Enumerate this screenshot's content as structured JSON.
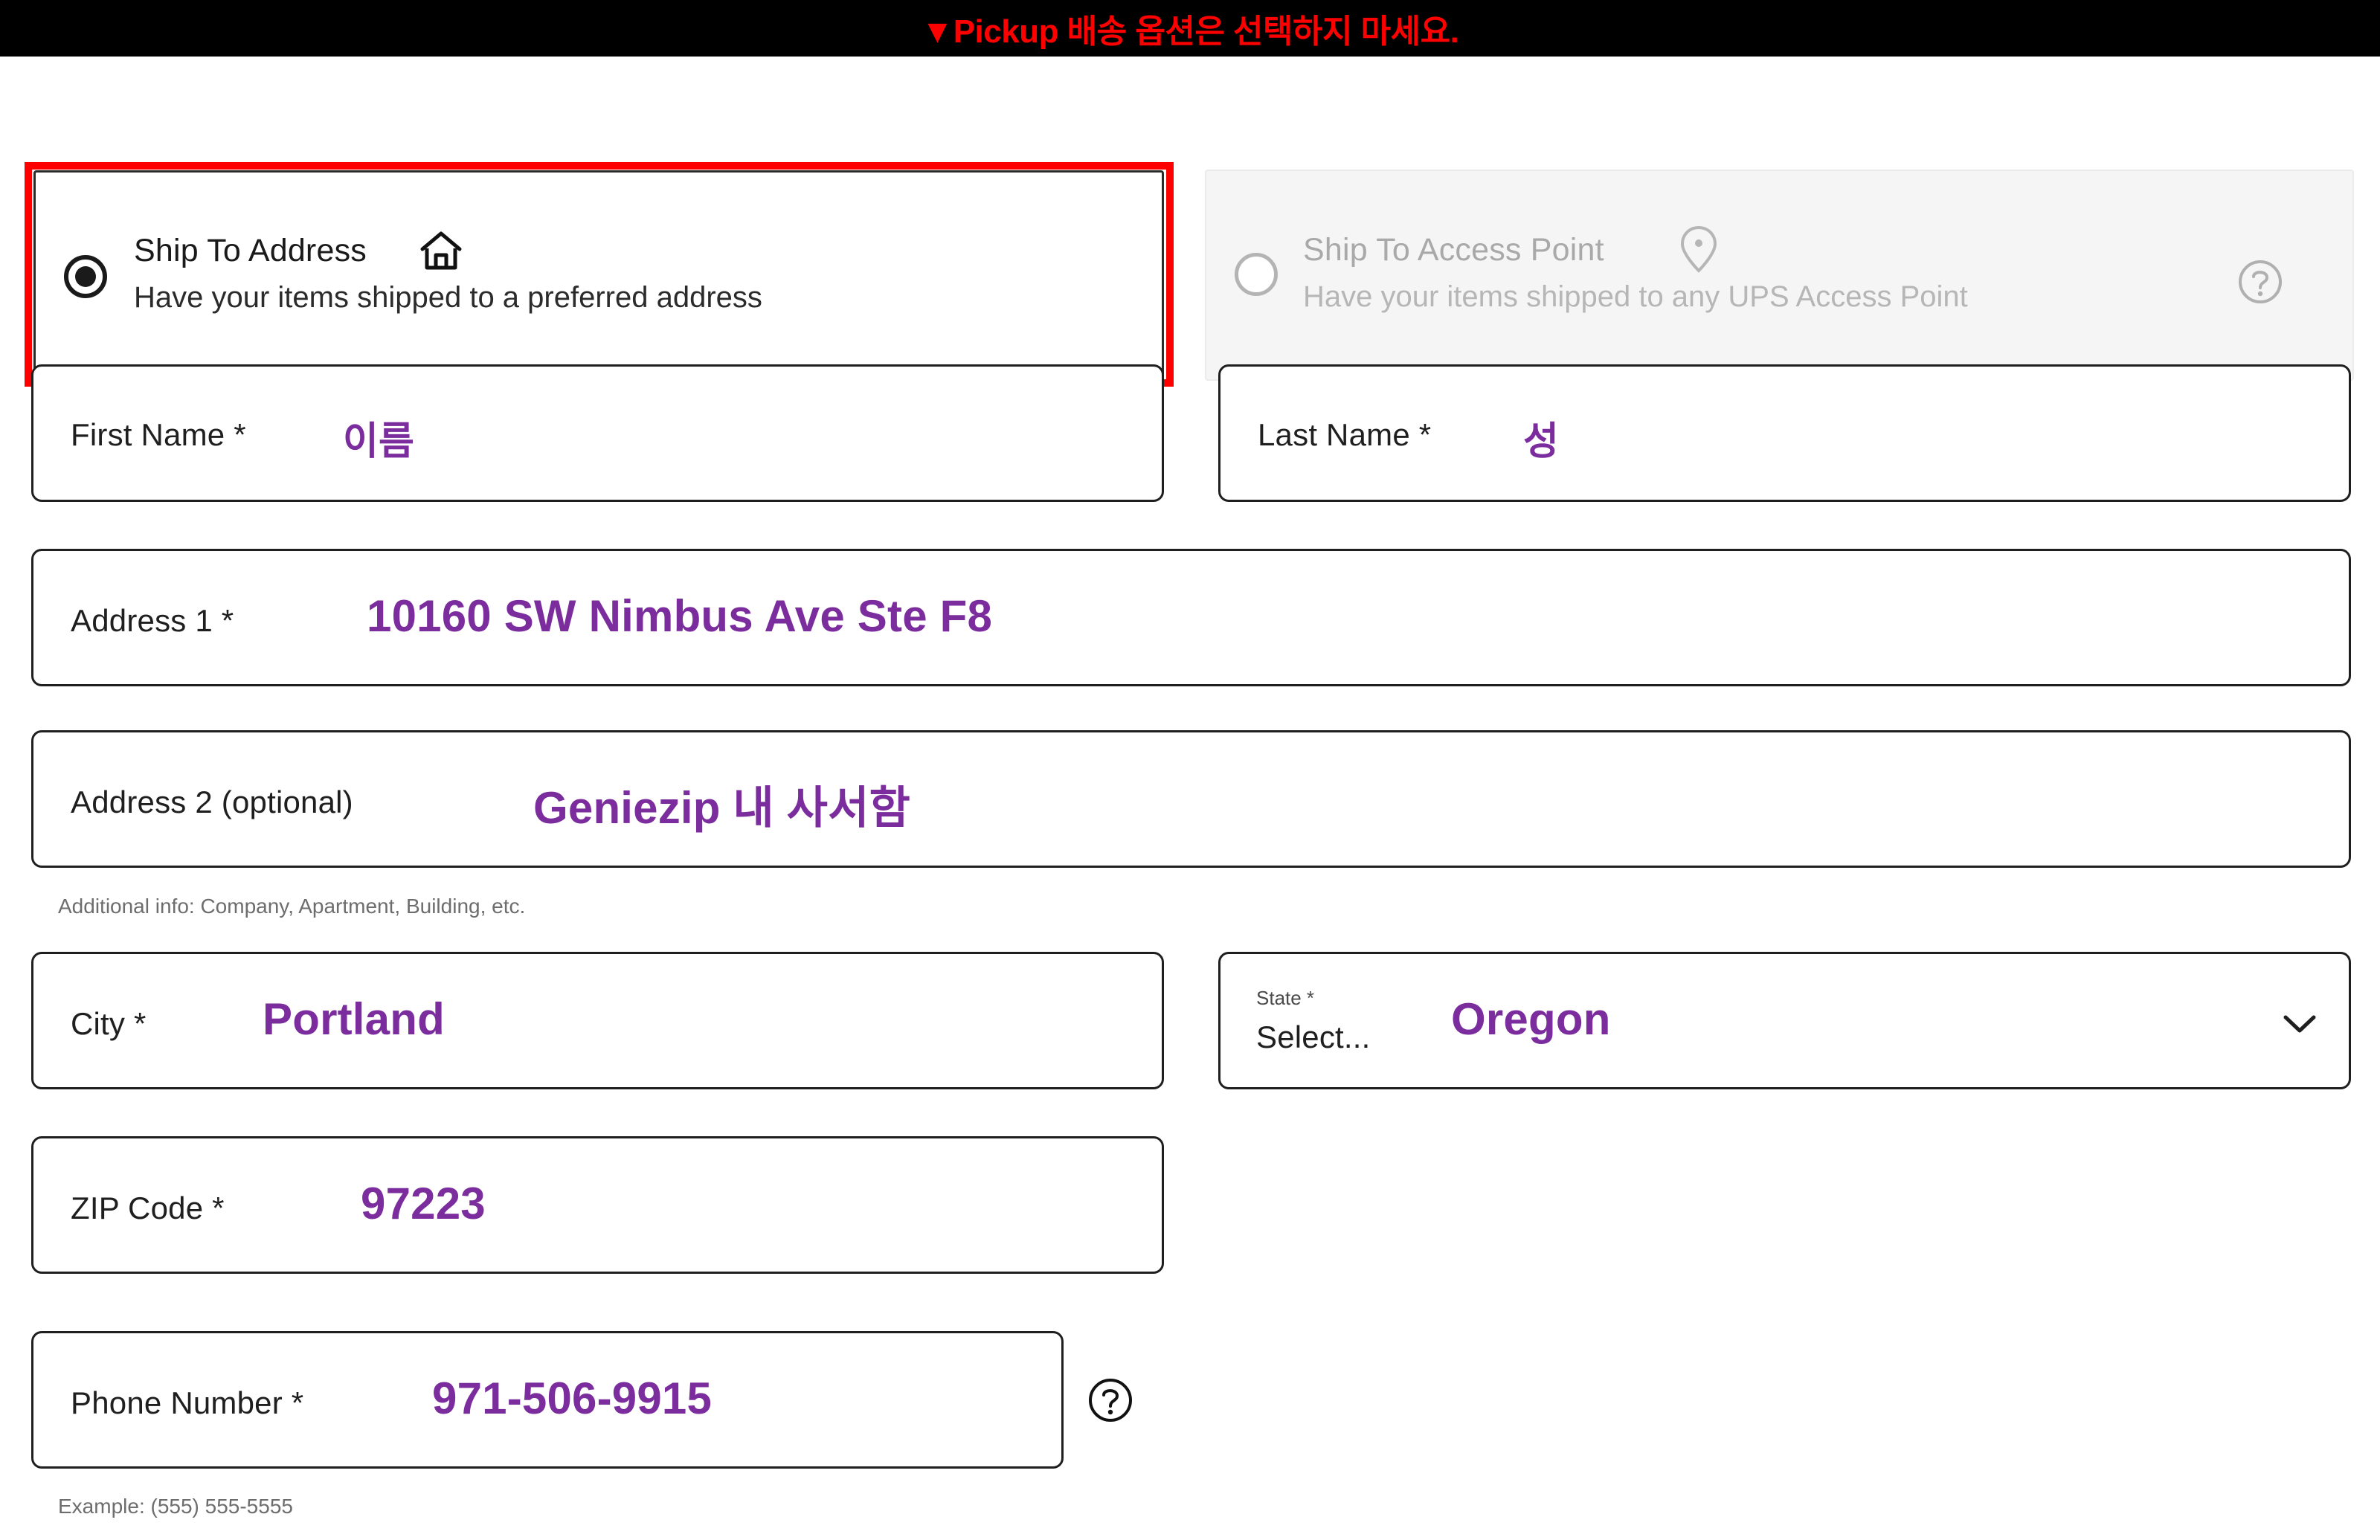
{
  "banner": {
    "text": "▼Pickup 배송 옵션은 선택하지 마세요."
  },
  "shipping_options": {
    "ship_to_address": {
      "title": "Ship To Address",
      "subtitle": "Have your items shipped to a preferred address",
      "icon": "home-icon",
      "selected": true,
      "highlighted": true
    },
    "ship_to_access_point": {
      "title": "Ship To Access Point",
      "subtitle": "Have your items shipped to any UPS Access Point",
      "icon": "map-pin-icon",
      "selected": false,
      "disabled": true,
      "help_icon": "help-circle-icon"
    }
  },
  "form": {
    "first_name": {
      "label": "First Name *",
      "value": "이름"
    },
    "last_name": {
      "label": "Last Name *",
      "value": "성"
    },
    "address1": {
      "label": "Address 1 *",
      "value": "10160 SW Nimbus Ave Ste F8"
    },
    "address2": {
      "label": "Address 2 (optional)",
      "value": "Geniezip 내 사서함",
      "helper": "Additional info: Company, Apartment, Building, etc."
    },
    "city": {
      "label": "City *",
      "value": "Portland"
    },
    "state": {
      "float_label": "State *",
      "placeholder": "Select...",
      "value": "Oregon",
      "chevron": "chevron-down-icon"
    },
    "zip": {
      "label": "ZIP Code *",
      "value": "97223"
    },
    "phone": {
      "label": "Phone Number *",
      "value": "971-506-9915",
      "helper": "Example: (555) 555-5555",
      "help_icon": "help-circle-icon"
    }
  },
  "colors": {
    "annotation_purple": "#7b2d9e",
    "highlight_red": "#ff0000",
    "banner_bg": "#000000",
    "disabled_gray": "#b6b6b6",
    "panel_gray": "#f5f5f5"
  }
}
